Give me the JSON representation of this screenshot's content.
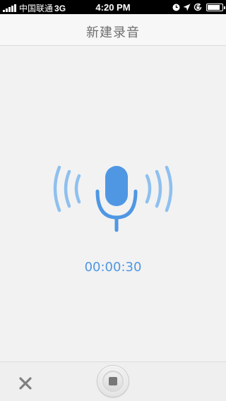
{
  "status_bar": {
    "carrier": "中国联通",
    "network": "3G",
    "time": "4:20 PM",
    "icons": [
      "clock-icon",
      "location-arrow-icon",
      "orientation-lock-icon",
      "battery-icon"
    ],
    "battery_level": 0.85
  },
  "nav": {
    "title": "新建录音"
  },
  "recorder": {
    "icon": "microphone-icon",
    "elapsed": "00:00:30",
    "accent_color": "#4f97e3",
    "wave_color": "#8ec0ef"
  },
  "toolbar": {
    "cancel_icon": "close-icon",
    "stop_icon": "stop-icon"
  }
}
